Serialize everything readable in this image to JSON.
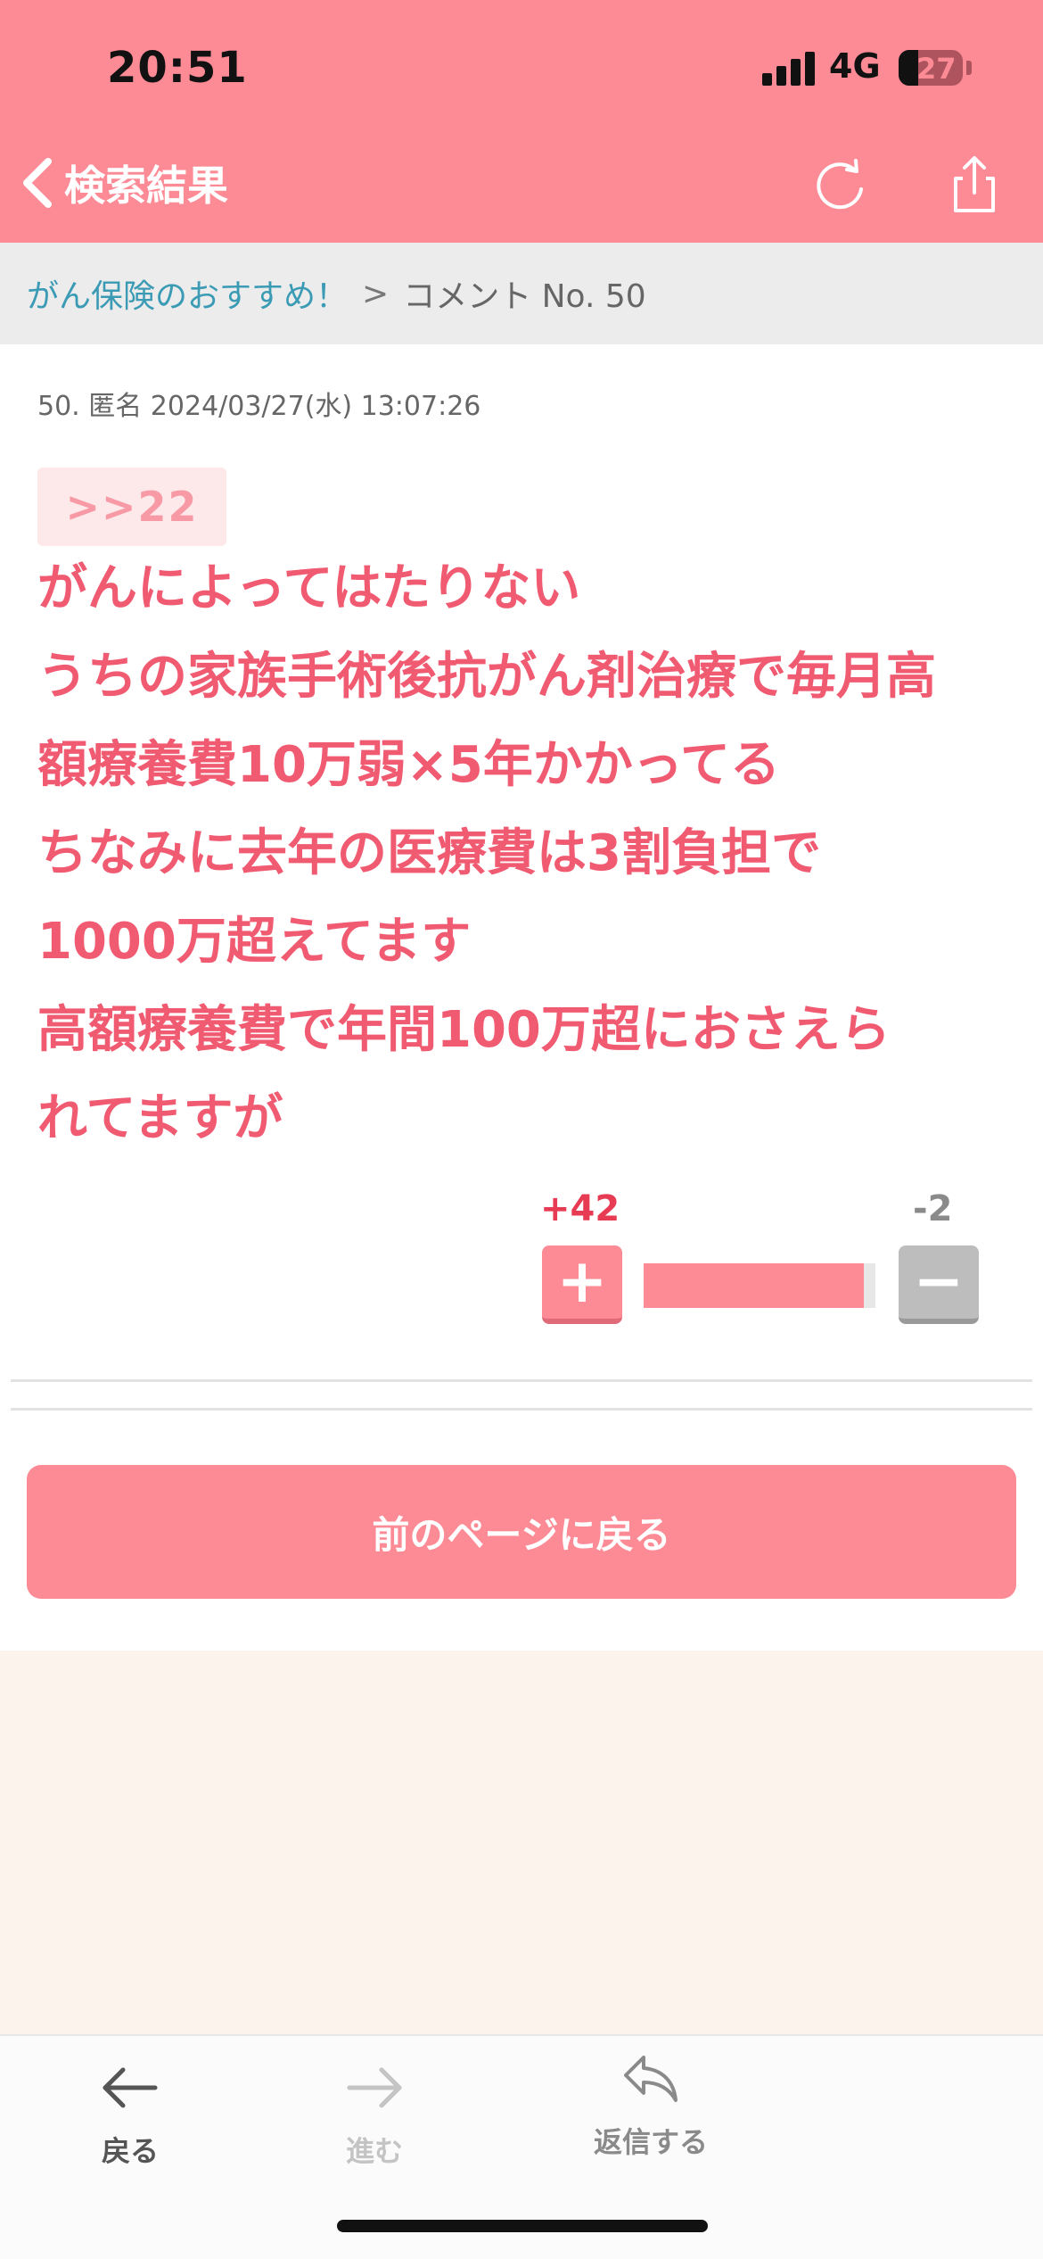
{
  "status_bar": {
    "time": "20:51",
    "network": "4G",
    "battery": "27"
  },
  "header": {
    "back_label": "検索結果",
    "icons": [
      "chevron-left-icon",
      "reload-icon",
      "share-icon"
    ]
  },
  "breadcrumb": {
    "link": "がん保険のおすすめ！",
    "separator": ">",
    "current": "コメント No. 50"
  },
  "comment": {
    "meta": "50. 匿名 2024/03/27(水) 13:07:26",
    "anchor": ">>22",
    "lines": [
      "がんによってはたりない",
      "うちの家族手術後抗がん剤治療で毎月高",
      "額療養費10万弱×5年かかってる",
      "ちなみに去年の医療費は3割負担で",
      "1000万超えてます",
      "高額療養費で年間100万超におさえら",
      "れてますが"
    ],
    "text_color": "#f05b72"
  },
  "votes": {
    "plus_count": "+42",
    "minus_count": "-2",
    "plus_symbol": "+",
    "minus_symbol": "−",
    "plus_ratio": 0.95,
    "plus_color": "#fd8b96",
    "minus_color": "#bdbdbd"
  },
  "prev_page_button": "前のページに戻る",
  "toolbar": {
    "back": "戻る",
    "forward": "進む",
    "reply": "返信する"
  },
  "colors": {
    "accent": "#fd8b96",
    "link": "#3b9bb5"
  }
}
